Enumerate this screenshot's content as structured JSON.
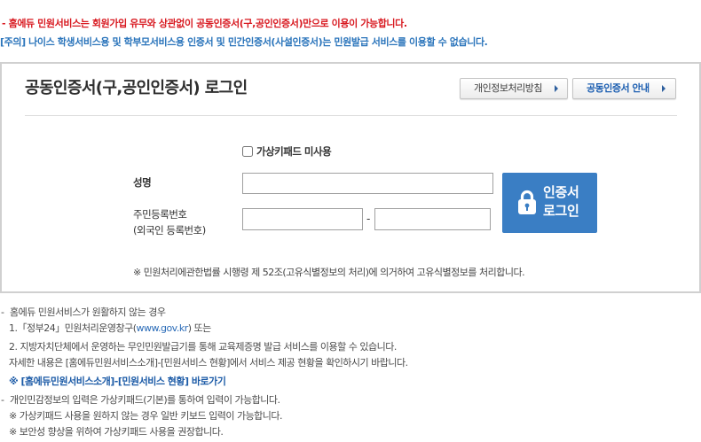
{
  "notices": {
    "primary": "- 홈에듀 민원서비스는 회원가입 유무와 상관없이 공동인증서(구,공인인증서)만으로 이용이 가능합니다.",
    "caution": "[주의] 나이스 학생서비스용 및 학부모서비스용 인증서 및 민간인증서(사설인증서)는 민원발급 서비스를 이용할 수 없습니다."
  },
  "login": {
    "title": "공동인증서(구,공인인증서) 로그인",
    "header_buttons": [
      {
        "label": "개인정보처리방침",
        "icon": "arrow-right-icon"
      },
      {
        "label": "공동인증서 안내",
        "icon": "arrow-right-icon"
      }
    ],
    "keypad_option": {
      "label": "가상키패드 미사용",
      "checked": false
    },
    "name_field": {
      "label": "성명",
      "value": ""
    },
    "rrn_field": {
      "label": "주민등록번호",
      "sublabel": "(외국인 등록번호)",
      "separator": "-",
      "front_value": "",
      "back_value": ""
    },
    "submit_button": {
      "line1": "인증서",
      "line2": "로그인",
      "icon": "lock-icon"
    },
    "legal_note": "※ 민원처리에관한법률 시행령 제 52조(고유식별정보의 처리)에 의거하여 고유식별정보를 처리합니다."
  },
  "help": {
    "bullet": "-",
    "outage_heading": "홈에듀 민원서비스가 원활하지 않는 경우",
    "option1": {
      "prefix": "1.「정부24」민원처리운영창구(",
      "link": "www.gov.kr",
      "suffix": ") 또는"
    },
    "option2": "2. 지방자치단체에서 운영하는 무인민원발급기를 통해 교육제증명 발급 서비스를 이용할 수 있습니다.",
    "details": "자세한 내용은 [홈에듀민원서비스소개]-[민원서비스 현황]에서 서비스 제공 현황을 확인하시기 바랍니다.",
    "shortcut_link": "※ [홈에듀민원서비스소개]-[민원서비스 현황] 바로가기",
    "keypad_heading": "개인민감정보의 입력은 가상키패드(기본)를 통하여 입력이 가능합니다.",
    "keypad_notes": [
      "※ 가상키패드 사용을 원하지 않는 경우 일반 키보드 입력이 가능합니다.",
      "※ 보안성 향상을 위하여 가상키패드 사용을 권장합니다."
    ]
  },
  "colors": {
    "notice_red": "#d81920",
    "notice_blue": "#2a74bb",
    "panel_border": "#d0d0d0",
    "guide_blue": "#1d5fb1",
    "submit_bg": "#3a7ec4",
    "gov_blue": "#2b6cb8",
    "link_blue": "#1c5ba7"
  }
}
